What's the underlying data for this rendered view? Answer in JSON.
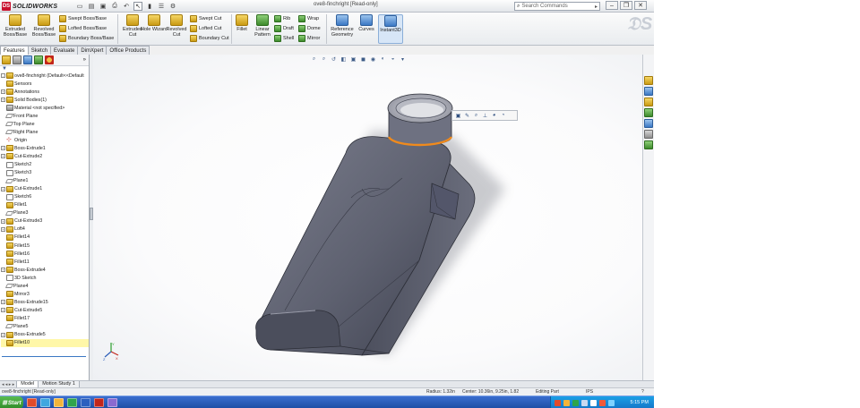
{
  "titlebar": {
    "brand": "SOLIDWORKS",
    "window_title": "ove8-finchright [Read-only]",
    "search_placeholder": "Search Commands",
    "search_go": "▸",
    "minimize": "–",
    "restore": "❐",
    "close": "✕"
  },
  "ribbon": {
    "extruded_boss": "Extruded Boss/Base",
    "revolved_boss": "Revolved Boss/Base",
    "swept_boss": "Swept Boss/Base",
    "lofted_boss": "Lofted Boss/Base",
    "boundary_boss": "Boundary Boss/Base",
    "extruded_cut": "Extruded Cut",
    "hole_wizard": "Hole Wizard",
    "revolved_cut": "Revolved Cut",
    "swept_cut": "Swept Cut",
    "lofted_cut": "Lofted Cut",
    "boundary_cut": "Boundary Cut",
    "fillet": "Fillet",
    "linear_pattern": "Linear Pattern",
    "rib": "Rib",
    "draft": "Draft",
    "shell": "Shell",
    "wrap": "Wrap",
    "dome": "Dome",
    "mirror": "Mirror",
    "reference_geometry": "Reference Geometry",
    "curves": "Curves",
    "instant3d": "Instant3D"
  },
  "manager_tabs": [
    "Features",
    "Sketch",
    "Evaluate",
    "DimXpert",
    "Office Products"
  ],
  "feature_tree": [
    {
      "label": "ove8-finchright (Default<<Default",
      "icon": "part",
      "exp": "-"
    },
    {
      "label": "Sensors",
      "icon": "folder",
      "exp": ""
    },
    {
      "label": "Annotations",
      "icon": "folder",
      "exp": "+"
    },
    {
      "label": "Solid Bodies(1)",
      "icon": "folder",
      "exp": "+"
    },
    {
      "label": "Material <not specified>",
      "icon": "material",
      "exp": ""
    },
    {
      "label": "Front Plane",
      "icon": "plane",
      "exp": ""
    },
    {
      "label": "Top Plane",
      "icon": "plane",
      "exp": ""
    },
    {
      "label": "Right Plane",
      "icon": "plane",
      "exp": ""
    },
    {
      "label": "Origin",
      "icon": "origin",
      "exp": ""
    },
    {
      "label": "Boss-Extrude1",
      "icon": "feature",
      "exp": "+"
    },
    {
      "label": "Cut-Extrude2",
      "icon": "feature",
      "exp": "+"
    },
    {
      "label": "Sketch2",
      "icon": "sketch",
      "exp": ""
    },
    {
      "label": "Sketch3",
      "icon": "sketch",
      "exp": ""
    },
    {
      "label": "Plane1",
      "icon": "plane",
      "exp": ""
    },
    {
      "label": "Cut-Extrude1",
      "icon": "feature",
      "exp": "+"
    },
    {
      "label": "Sketch6",
      "icon": "sketch",
      "exp": ""
    },
    {
      "label": "Fillet1",
      "icon": "fillet",
      "exp": ""
    },
    {
      "label": "Plane3",
      "icon": "plane",
      "exp": ""
    },
    {
      "label": "Cut-Extrude3",
      "icon": "feature",
      "exp": "+"
    },
    {
      "label": "Loft4",
      "icon": "feature",
      "exp": "+"
    },
    {
      "label": "Fillet14",
      "icon": "fillet",
      "exp": ""
    },
    {
      "label": "Fillet15",
      "icon": "fillet",
      "exp": ""
    },
    {
      "label": "Fillet16",
      "icon": "fillet",
      "exp": ""
    },
    {
      "label": "Fillet11",
      "icon": "fillet",
      "exp": ""
    },
    {
      "label": "Boss-Extrude4",
      "icon": "feature",
      "exp": "+"
    },
    {
      "label": "3D Sketch",
      "icon": "sketch",
      "exp": ""
    },
    {
      "label": "Plane4",
      "icon": "plane",
      "exp": ""
    },
    {
      "label": "Mirror3",
      "icon": "feature",
      "exp": ""
    },
    {
      "label": "Boss-Extrude15",
      "icon": "feature",
      "exp": "+"
    },
    {
      "label": "Cut-Extrude5",
      "icon": "feature",
      "exp": "+"
    },
    {
      "label": "Fillet17",
      "icon": "fillet",
      "exp": ""
    },
    {
      "label": "Plane5",
      "icon": "plane",
      "exp": ""
    },
    {
      "label": "Boss-Extrude5",
      "icon": "feature",
      "exp": "+"
    },
    {
      "label": "Fillet10",
      "icon": "fillet",
      "exp": "",
      "selected": true
    }
  ],
  "bottom_tabs": [
    "Model",
    "Motion Study 1"
  ],
  "status": {
    "left": "ove8-finchright [Read-only]",
    "radius": "Radius: 1.32in",
    "center": "Center: 10.36in, 9.25in, 1.82",
    "editing": "Editing Part",
    "units": "IPS",
    "help": "?"
  },
  "taskbar": {
    "start": "Start",
    "clock": "5:15 PM"
  },
  "colors": {
    "model_body": "#5e6170",
    "highlight_edge": "#f08a1c",
    "selection": "#fff7a8"
  }
}
